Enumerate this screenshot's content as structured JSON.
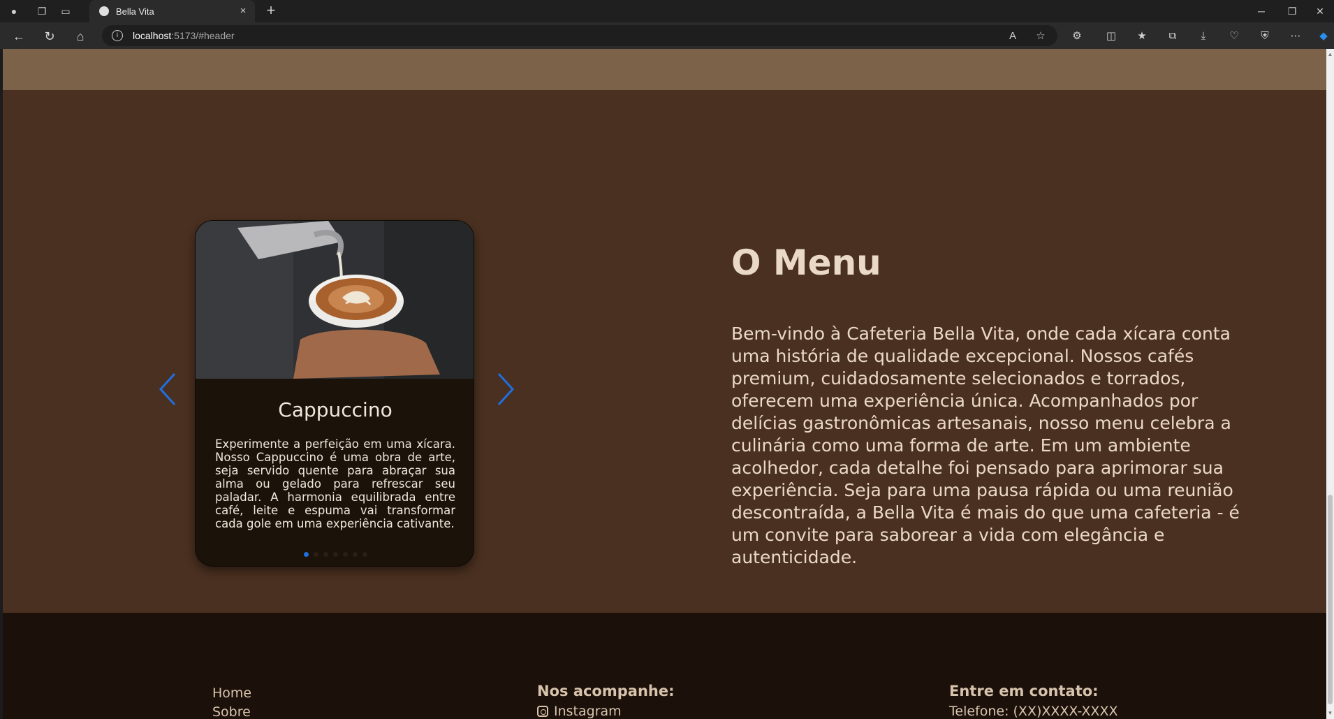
{
  "browser": {
    "tab_title": "Bella Vita",
    "tab_close": "×",
    "new_tab": "+",
    "url_host": "localhost",
    "url_path": ":5173/#header"
  },
  "carousel": {
    "item_title": "Cappuccino",
    "item_description": "Experimente a perfeição em uma xícara. Nosso Cappuccino é uma obra de arte, seja servido quente para abraçar sua alma ou gelado para refrescar seu paladar. A harmonia equilibrada entre café, leite e espuma vai transformar cada gole em uma experiência cativante.",
    "slide_count": 7,
    "active_index": 0,
    "accent_color": "#1f6fe0"
  },
  "menu": {
    "title": "O Menu",
    "description": "Bem-vindo à Cafeteria Bella Vita, onde cada xícara conta uma história de qualidade excepcional. Nossos cafés premium, cuidadosamente selecionados e torrados, oferecem uma experiência única. Acompanhados por delícias gastronômicas artesanais, nosso menu celebra a culinária como uma forma de arte. Em um ambiente acolhedor, cada detalhe foi pensado para aprimorar sua experiência. Seja para uma pausa rápida ou uma reunião descontraída, a Bella Vita é mais do que uma cafeteria - é um convite para saborear a vida com elegância e autenticidade."
  },
  "footer": {
    "links": [
      "Home",
      "Sobre"
    ],
    "social_title": "Nos acompanhe:",
    "social_instagram": "Instagram",
    "contact_title": "Entre em contato:",
    "contact_phone": "Telefone: (XX)XXXX-XXXX"
  },
  "colors": {
    "top_band": "#7c6249",
    "section_bg": "#4a3020",
    "card_bg": "#1b120a",
    "footer_bg": "#1b110a",
    "text_light": "#ead9c6"
  }
}
